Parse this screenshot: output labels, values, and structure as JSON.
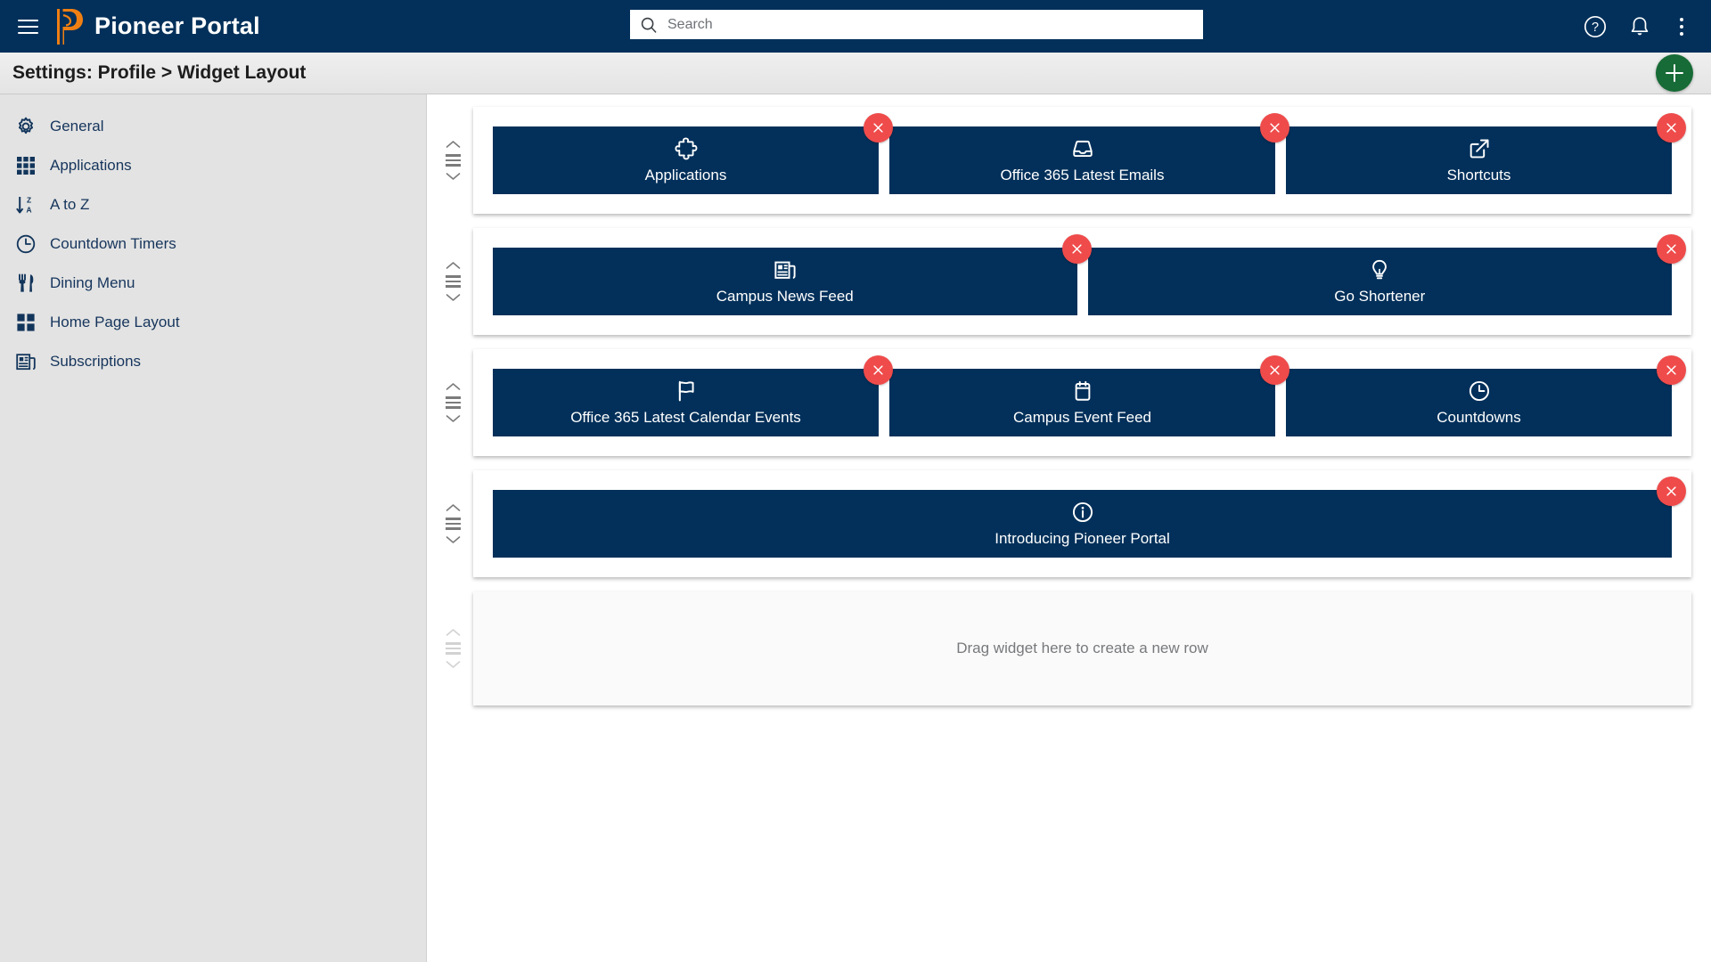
{
  "header": {
    "menu_icon": "hamburger-menu-icon",
    "logo_icon": "pioneer-p-logo",
    "title": "Pioneer Portal",
    "brand_navy": "#02305a",
    "brand_orange": "#f07f13",
    "search": {
      "placeholder": "Search",
      "value": "",
      "icon": "search-icon"
    },
    "actions": [
      {
        "name": "help-icon",
        "label": "Help"
      },
      {
        "name": "notifications-bell-icon",
        "label": "Notifications"
      },
      {
        "name": "overflow-menu-icon",
        "label": "More options"
      }
    ]
  },
  "toolbar": {
    "title": "Settings: Profile > Widget Layout",
    "add_button": {
      "name": "add-widget-button",
      "label": "Add",
      "color": "#176b36"
    }
  },
  "sidebar": {
    "items": [
      {
        "label": "General",
        "icon": "gear-icon"
      },
      {
        "label": "Applications",
        "icon": "grid-3x3-icon"
      },
      {
        "label": "A to Z",
        "icon": "sort-alpha-icon"
      },
      {
        "label": "Countdown Timers",
        "icon": "clock-icon"
      },
      {
        "label": "Dining Menu",
        "icon": "fork-knife-icon"
      },
      {
        "label": "Home Page Layout",
        "icon": "grid-2x2-icon"
      },
      {
        "label": "Subscriptions",
        "icon": "newspaper-icon"
      }
    ]
  },
  "main": {
    "widget_color": "#02305a",
    "remove_color": "#ef4b4b",
    "remove_icon": "close-x-icon",
    "rows": [
      {
        "handle": "drag-handle",
        "disabled": false,
        "widgets": [
          {
            "label": "Applications",
            "icon": "puzzle-piece-icon",
            "flex": 376
          },
          {
            "label": "Office 365 Latest Emails",
            "icon": "inbox-tray-icon",
            "flex": 376
          },
          {
            "label": "Shortcuts",
            "icon": "external-link-icon",
            "flex": 376
          }
        ]
      },
      {
        "handle": "drag-handle",
        "disabled": false,
        "widgets": [
          {
            "label": "Campus News Feed",
            "icon": "newspaper-icon",
            "flex": 570
          },
          {
            "label": "Go Shortener",
            "icon": "lightbulb-icon",
            "flex": 570
          }
        ]
      },
      {
        "handle": "drag-handle",
        "disabled": false,
        "widgets": [
          {
            "label": "Office 365 Latest Calendar Events",
            "icon": "flag-icon",
            "flex": 420
          },
          {
            "label": "Campus Event Feed",
            "icon": "calendar-icon",
            "flex": 420
          },
          {
            "label": "Countdowns",
            "icon": "clock-icon",
            "flex": 420
          }
        ]
      },
      {
        "handle": "drag-handle",
        "disabled": false,
        "widgets": [
          {
            "label": "Introducing Pioneer Portal",
            "icon": "info-circle-icon",
            "flex": 1
          }
        ]
      }
    ],
    "dropzone": {
      "handle": "drag-handle-disabled",
      "text": "Drag widget here to create a new row"
    }
  }
}
